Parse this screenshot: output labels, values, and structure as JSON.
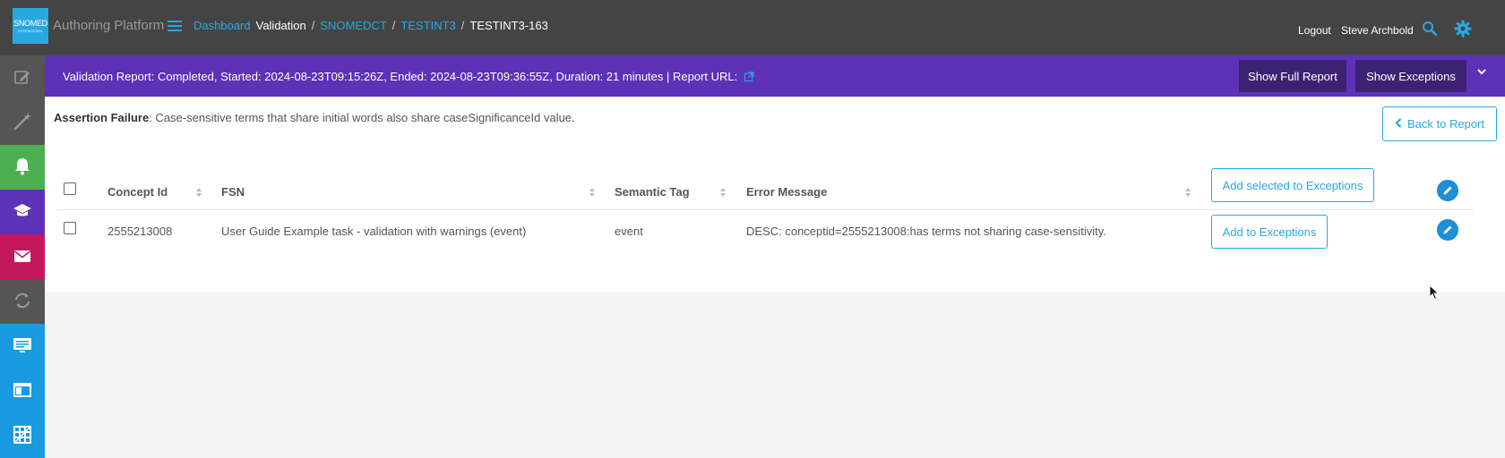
{
  "header": {
    "logo_text": "SNOMED",
    "logo_subtext": "INTERNATIONAL",
    "app_title": "Authoring Platform",
    "breadcrumb": {
      "dashboard": "Dashboard",
      "validation": "Validation",
      "sep": "/",
      "codesystem": "SNOMEDCT",
      "project": "TESTINT3",
      "task": "TESTINT3-163"
    },
    "logout": "Logout",
    "user": "Steve Archbold"
  },
  "sidebar": {
    "items": [
      {
        "icon": "edit-icon",
        "color": "#555555"
      },
      {
        "icon": "magic-wand-icon",
        "color": "#555555"
      },
      {
        "icon": "bell-icon",
        "color": "#4caf50"
      },
      {
        "icon": "graduation-cap-icon",
        "color": "#5d32b7"
      },
      {
        "icon": "envelope-icon",
        "color": "#c2185b"
      },
      {
        "icon": "sync-icon",
        "color": "#555555"
      },
      {
        "icon": "monitor-icon",
        "color": "#1a9ae0"
      },
      {
        "icon": "browser-window-icon",
        "color": "#1a9ae0"
      },
      {
        "icon": "grid-icon",
        "color": "#1a9ae0"
      }
    ]
  },
  "banner": {
    "text": "Validation Report: Completed, Started: 2024-08-23T09:15:26Z, Ended: 2024-08-23T09:36:55Z, Duration: 21 minutes | Report URL:",
    "show_full_report": "Show Full Report",
    "show_exceptions": "Show Exceptions"
  },
  "main": {
    "assertion_label": "Assertion Failure",
    "assertion_text": ": Case-sensitive terms that share initial words also share caseSignificanceId value.",
    "back_button": "Back to Report",
    "table": {
      "columns": [
        "Concept Id",
        "FSN",
        "Semantic Tag",
        "Error Message"
      ],
      "add_selected": "Add selected to Exceptions",
      "rows": [
        {
          "concept_id": "2555213008",
          "fsn": "User Guide Example task - validation with warnings (event)",
          "semantic_tag": "event",
          "error_message": "DESC: conceptid=2555213008:has terms not sharing case-sensitivity.",
          "action": "Add to Exceptions"
        }
      ]
    }
  },
  "colors": {
    "topbar": "#444444",
    "banner": "#5d32b7",
    "accent": "#29a8e0",
    "dark_button": "#3d2274"
  }
}
